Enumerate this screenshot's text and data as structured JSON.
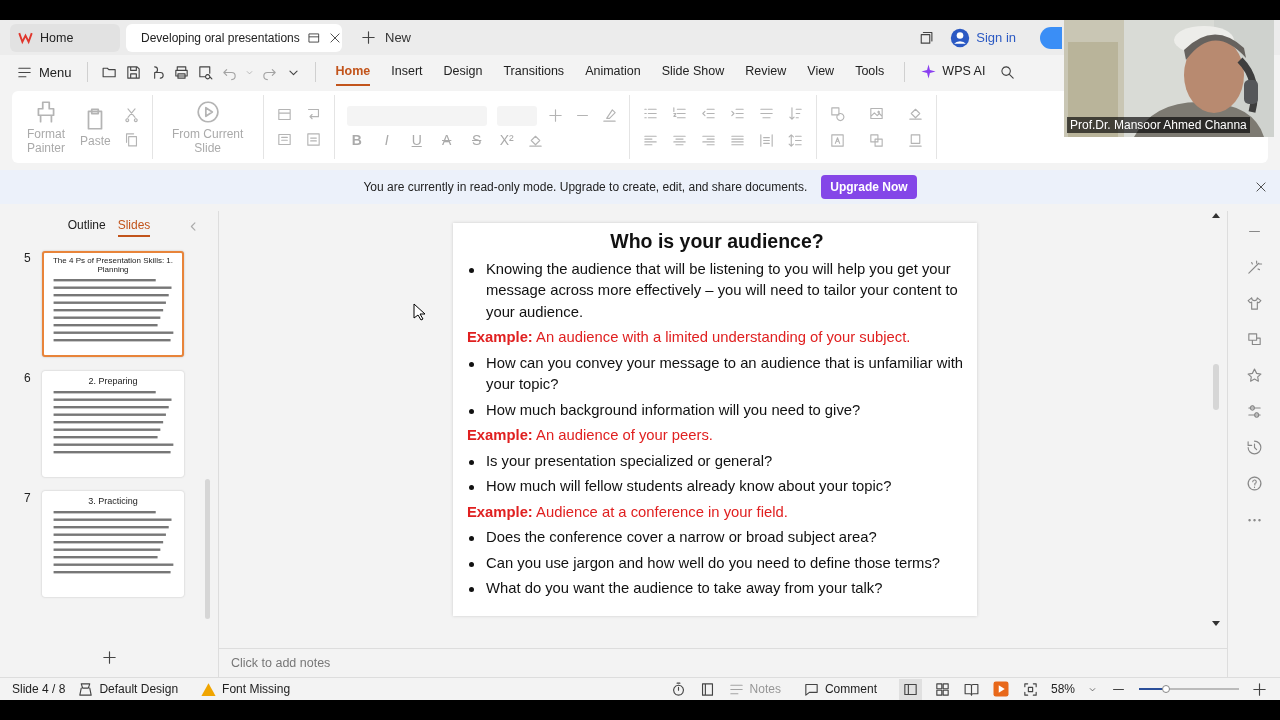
{
  "tabs": [
    {
      "label": "Home",
      "selected": false
    },
    {
      "label": "Developing oral presentations",
      "selected": true
    }
  ],
  "new_tab": "New",
  "sign_in": "Sign in",
  "menu_label": "Menu",
  "ribbon_tabs": [
    {
      "label": "Home",
      "selected": true
    },
    {
      "label": "Insert",
      "selected": false
    },
    {
      "label": "Design",
      "selected": false
    },
    {
      "label": "Transitions",
      "selected": false
    },
    {
      "label": "Animation",
      "selected": false
    },
    {
      "label": "Slide Show",
      "selected": false
    },
    {
      "label": "Review",
      "selected": false
    },
    {
      "label": "View",
      "selected": false
    },
    {
      "label": "Tools",
      "selected": false
    }
  ],
  "wps_ai": "WPS AI",
  "ribbon": {
    "disabled": true,
    "large_buttons": [
      "Format Painter",
      "Paste",
      "From Current Slide"
    ],
    "format_buttons": [
      "B",
      "I",
      "U",
      "A",
      "S",
      "X²"
    ]
  },
  "notice": {
    "text": "You are currently in read-only mode. Upgrade to create, edit, and share documents.",
    "button": "Upgrade Now"
  },
  "panel_tabs": [
    {
      "label": "Outline",
      "selected": false
    },
    {
      "label": "Slides",
      "selected": true
    }
  ],
  "thumbnails": [
    {
      "number": "5",
      "title": "The 4 Ps of Presentation Skills: 1. Planning",
      "selected": true
    },
    {
      "number": "6",
      "title": "2. Preparing",
      "selected": false
    },
    {
      "number": "7",
      "title": "3. Practicing",
      "selected": false
    }
  ],
  "slide": {
    "title": "Who is your audience?",
    "items": [
      {
        "kind": "bullet",
        "text": "Knowing the audience that will be listening to you will help you get your message across more effectively – you will need to tailor your content to your audience."
      },
      {
        "kind": "example",
        "label": "Example:",
        "text": "An audience with a limited understanding of your subject."
      },
      {
        "kind": "bullet",
        "text": "How can you convey your message to an audience that is unfamiliar with your topic?"
      },
      {
        "kind": "bullet",
        "text": "How much background information will you need to give?"
      },
      {
        "kind": "example",
        "label": "Example:",
        "text": "An audience of your peers."
      },
      {
        "kind": "bullet",
        "text": "Is your presentation specialized or general?"
      },
      {
        "kind": "bullet",
        "text": "How much will fellow students already know about your topic?"
      },
      {
        "kind": "example",
        "label": "Example:",
        "text": "Audience at a conference in your field."
      },
      {
        "kind": "bullet",
        "text": "Does the conference cover a narrow or broad subject area?"
      },
      {
        "kind": "bullet",
        "text": "Can you use jargon and how well do you need to define those terms?"
      },
      {
        "kind": "bullet",
        "text": "What do you want the audience to take away from your talk?"
      }
    ]
  },
  "notes_placeholder": "Click to add notes",
  "status_bar": {
    "slide": "Slide 4 / 8",
    "design": "Default Design",
    "font_missing": "Font Missing",
    "notes": "Notes",
    "comment": "Comment",
    "zoom": "58%",
    "zoom_slider": {
      "level": 0.27
    }
  },
  "webcam": {
    "name": "Prof.Dr. Mansoor Ahmed Channa"
  }
}
